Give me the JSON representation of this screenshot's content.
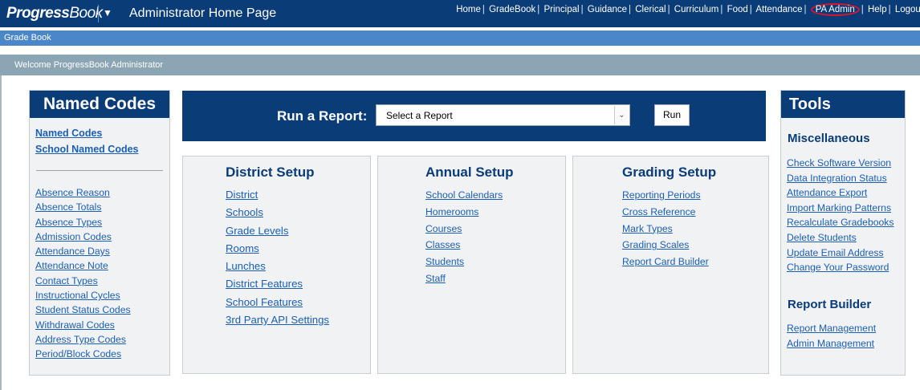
{
  "header": {
    "logo_progress": "Progress",
    "logo_book": "Book",
    "app_title": "Administrator Home Page",
    "nav": [
      "Home",
      "GradeBook",
      "Principal",
      "Guidance",
      "Clerical",
      "Curriculum",
      "Food",
      "Attendance",
      "PA Admin",
      "Help",
      "Logout"
    ]
  },
  "gradebar": {
    "label": "Grade Book"
  },
  "welcome": {
    "text": "Welcome ProgressBook Administrator"
  },
  "named_codes": {
    "title": "Named Codes",
    "top_links": [
      "Named Codes",
      "School Named Codes"
    ],
    "codes": [
      "Absence Reason",
      "Absence Totals",
      "Absence Types",
      "Admission Codes",
      "Attendance Days",
      "Attendance Note",
      "Contact Types",
      "Instructional Cycles",
      "Student Status Codes",
      "Withdrawal Codes",
      "Address Type Codes",
      "Period/Block Codes"
    ]
  },
  "report": {
    "label": "Run a Report:",
    "select_value": "Select a Report",
    "run_label": "Run"
  },
  "district_setup": {
    "title": "District Setup",
    "links": [
      "District",
      "Schools",
      "Grade Levels",
      "Rooms",
      "Lunches",
      "District Features",
      "School Features",
      "3rd Party API Settings"
    ]
  },
  "annual_setup": {
    "title": "Annual Setup",
    "links": [
      "School Calendars",
      "Homerooms",
      "Courses",
      "Classes",
      "Students",
      "Staff"
    ]
  },
  "grading_setup": {
    "title": "Grading Setup",
    "links": [
      "Reporting Periods",
      "Cross Reference",
      "Mark Types",
      "Grading Scales",
      "Report Card Builder"
    ]
  },
  "tools": {
    "title": "Tools",
    "misc_title": "Miscellaneous",
    "misc_links": [
      "Check Software Version",
      "Data Integration Status",
      "Attendance Export",
      "Import Marking Patterns",
      "Recalculate Gradebooks",
      "Delete Students",
      "Update Email Address",
      "Change Your Password"
    ],
    "report_builder_title": "Report Builder",
    "report_builder_links": [
      "Report Management",
      "Admin Management"
    ]
  },
  "colors": {
    "header": "#0a3c78",
    "gradebar": "#4a86c8",
    "welcomebar": "#8ca5b5",
    "link": "#1a5fb4",
    "highlight_circle": "#e0132e"
  }
}
